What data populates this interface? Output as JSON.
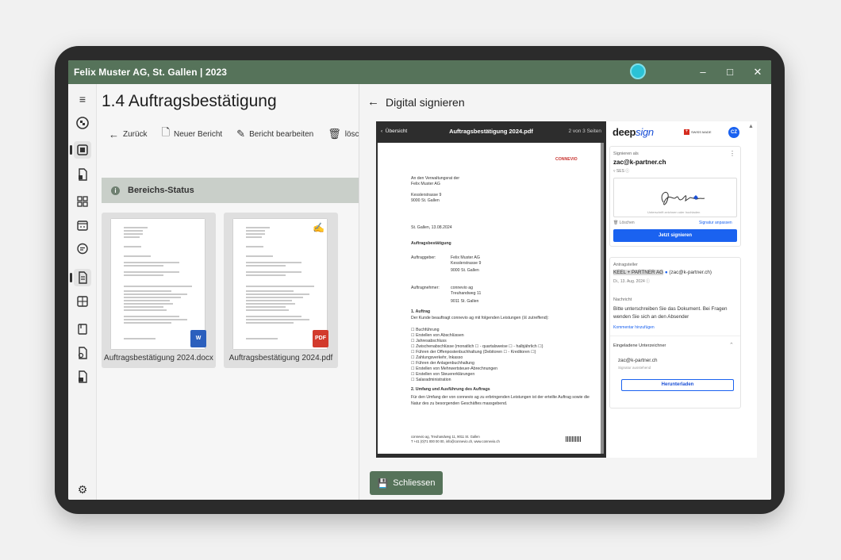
{
  "window": {
    "title": "Felix Muster AG, St. Gallen | 2023"
  },
  "page": {
    "title": "1.4 Auftragsbestätigung"
  },
  "toolbar": {
    "back": "Zurück",
    "new_report": "Neuer Bericht",
    "edit_report": "Bericht bearbeiten",
    "delete": "löschen"
  },
  "section": {
    "status_title": "Bereichs-Status"
  },
  "files": [
    {
      "name": "Auftragsbestätigung 2024.docx",
      "badge": "W"
    },
    {
      "name": "Auftragsbestätigung 2024.pdf",
      "badge": "PDF"
    }
  ],
  "panel": {
    "title": "Digital signieren",
    "close_label": "Schliessen"
  },
  "viewer": {
    "back_label": "Übersicht",
    "filename": "Auftragsbestätigung 2024.pdf",
    "page_info": "2 von 3 Seiten"
  },
  "pdf": {
    "brand": "CONNEVIO",
    "recipient_1": "An den Verwaltungsrat der",
    "recipient_2": "Felix Muster AG",
    "recipient_3": "Kesslerstrasse 9",
    "recipient_4": "9000 St. Gallen",
    "date": "St. Gallen, 13.08.2024",
    "heading": "Auftragsbestätigung",
    "client_label": "Auftraggeber:",
    "client_1": "Felix Muster AG",
    "client_2": "Kesslerstrasse 9",
    "client_3": "9000 St. Gallen",
    "contractor_label": "Auftragnehmer:",
    "contractor_1": "connevio ag",
    "contractor_2": "Treuhandweg 11",
    "contractor_3": "9011 St. Gallen",
    "s1": "1.   Auftrag",
    "s1_text": "Der Kunde beauftragt connevio ag  mit folgenden Leistungen (☒ zutreffend):",
    "items": [
      "☐      Buchführung",
      "☐      Erstellen von Abschlüssen",
      "☐          Jahresabschluss",
      "☐          Zwischenabschlüsse (monatlich ☐ - quartalsweise ☐ - halbjährlich ☐)",
      "☐      Führen der Offenpostenbuchhaltung (Debitoren ☐ - Kreditoren ☐)",
      "☐      Zahlungsverkehr, Inkasso",
      "☐      Führen der Anlagenbuchhaltung",
      "☐      Erstellen von Mehrwertsteuer-Abrechnungen",
      "☐      Erstellen von Steuererklärungen",
      "☐      Salaradministration"
    ],
    "s2": "2.   Umfang und Ausführung des Auftrags",
    "s2_text_1": "Für den Umfang der von connevio ag zu erbringenden Leistungen ist der erteilte Auftrag sowie die",
    "s2_text_2": "Natur des zu besorgenden Geschäftes massgebend.",
    "footer_1": "connevio ag, Treuhandweg 11, 9011 St. Gallen",
    "footer_2": "T +41 (0)71 000 00 00, info@connevio.ch, www.connevio.ch"
  },
  "deepsign": {
    "logo_a": "deep",
    "logo_b": "sign",
    "swiss_label": "SWISS MADE",
    "avatar": "CZ",
    "sign_as": "Signieren als",
    "email": "zac@k-partner.ch",
    "level": "SES",
    "sig_caption": "Unterschrift zeichnen oder",
    "sig_upload": "hochladen",
    "delete": "Löschen",
    "adjust": "Signatur anpassen",
    "sign_button": "Jetzt signieren",
    "requester_label": "Antragsteller",
    "requester": "KEEL + PARTNER AG",
    "requester_email": "(zac@k-partner.ch)",
    "requested_date": "Di., 13. Aug. 2024",
    "message_label": "Nachricht",
    "message_1": "Bitte unterschreiben Sie das Dokument. Bei Fragen",
    "message_2": "wenden Sie sich an den Absender",
    "add_comment": "Kommentar hinzufügen",
    "invited_label": "Eingeladene Unterzeichner",
    "invitee": "zac@k-partner.ch",
    "invitee_status": "Signatur ausstehend",
    "download": "Herunterladen"
  }
}
